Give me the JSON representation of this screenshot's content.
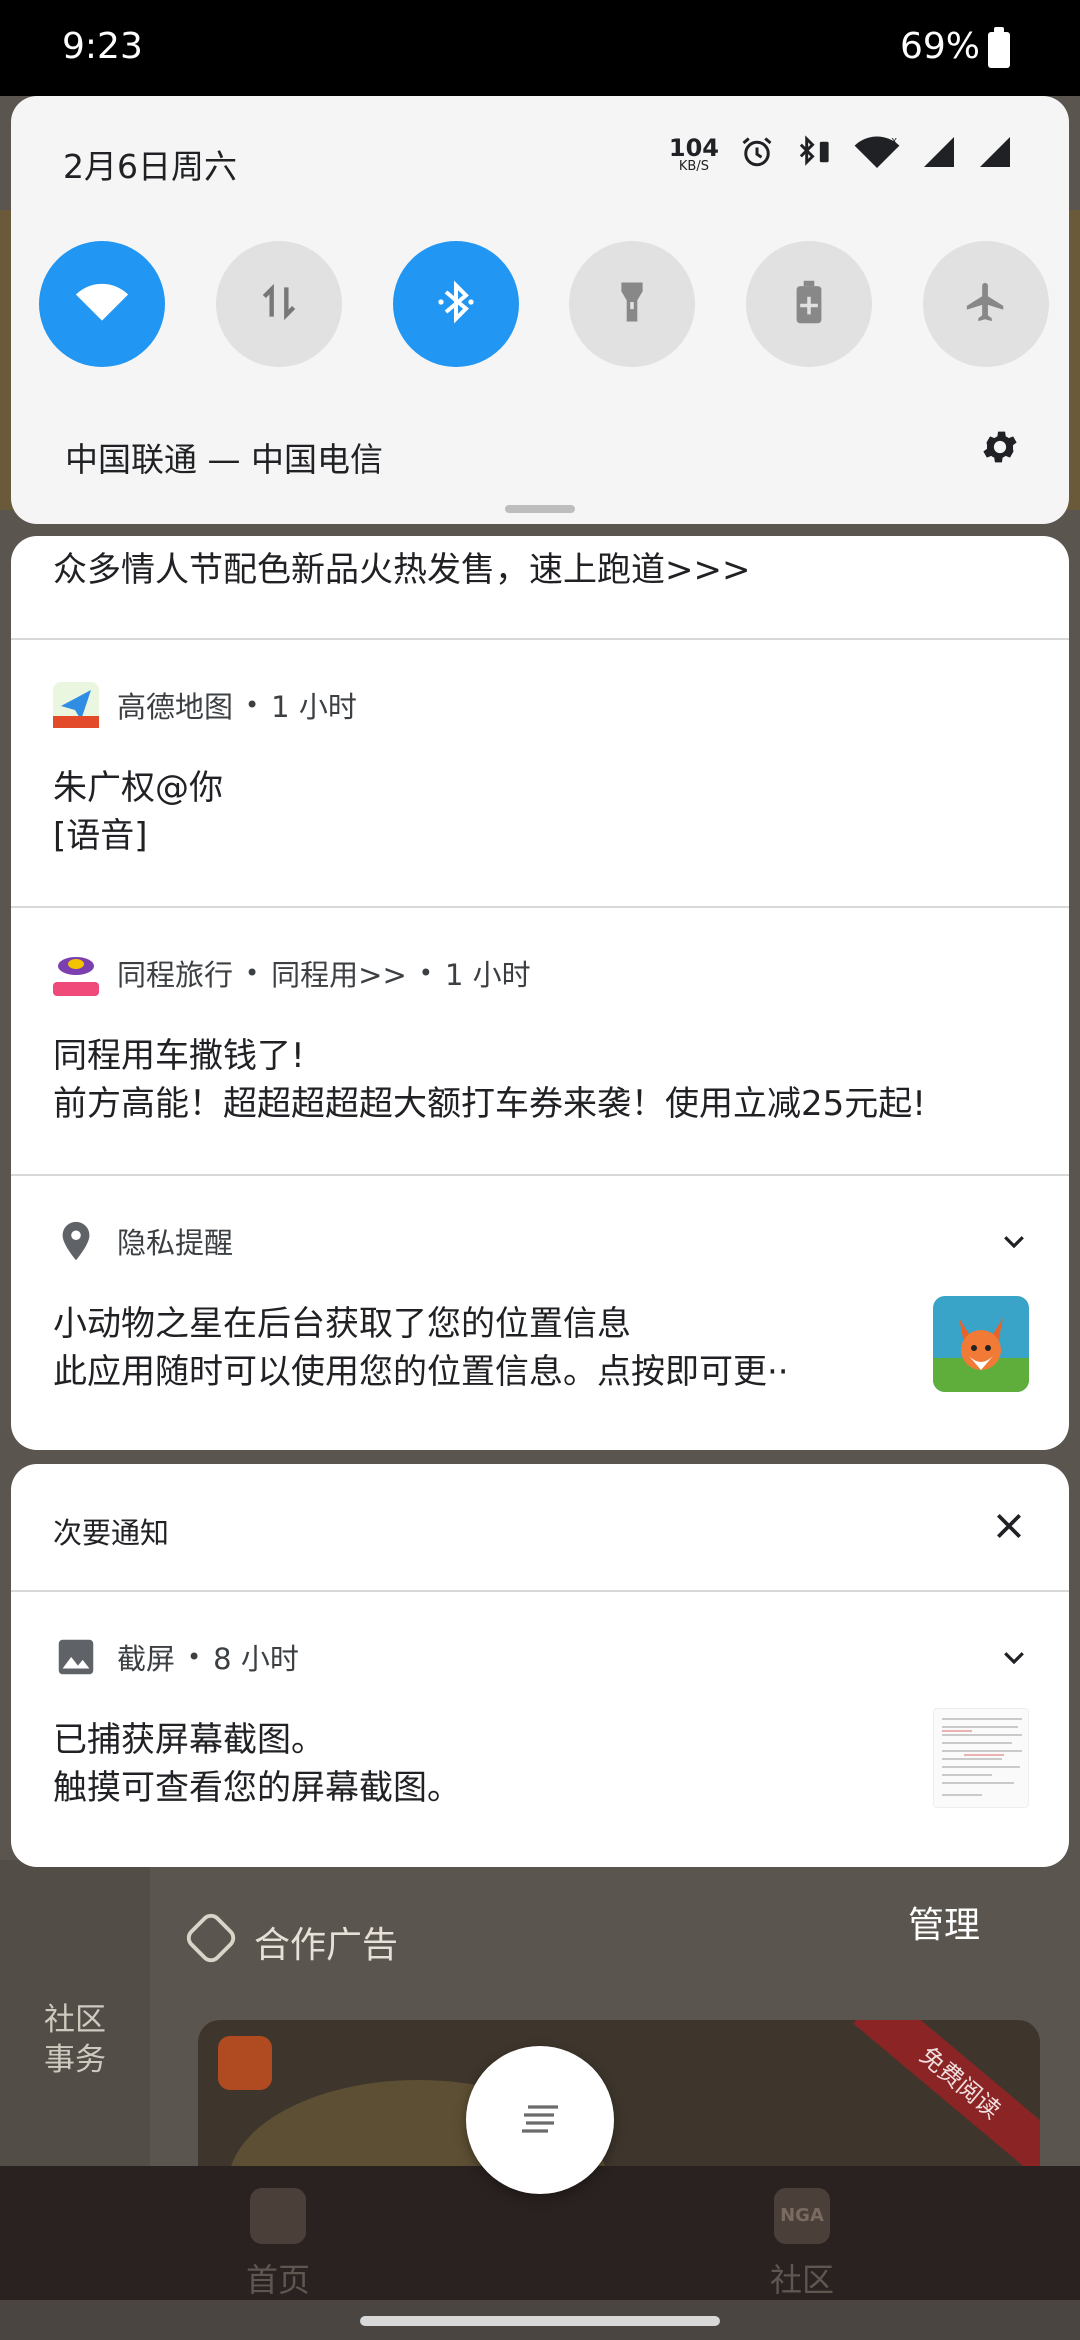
{
  "status_bar": {
    "time": "9:23",
    "battery": "69%"
  },
  "quick_settings": {
    "date": "2月6日周六",
    "speed_value": "104",
    "speed_unit": "KB/S",
    "carrier": "中国联通 — 中国电信",
    "tiles": [
      {
        "name": "wifi",
        "on": true
      },
      {
        "name": "mobile-data",
        "on": false
      },
      {
        "name": "bluetooth",
        "on": true
      },
      {
        "name": "flashlight",
        "on": false
      },
      {
        "name": "battery-saver",
        "on": false
      },
      {
        "name": "airplane-mode",
        "on": false
      }
    ],
    "accent_color": "#2196f3"
  },
  "notifications": {
    "partial_text": "众多情人节配色新品火热发售，速上跑道>>>",
    "amap": {
      "app_name": "高德地图",
      "time": "1 小时",
      "title": "朱广权@你",
      "body": "[语音]"
    },
    "tongcheng": {
      "app_name": "同程旅行",
      "channel": "同程用>>",
      "time": "1 小时",
      "title": "同程用车撒钱了!",
      "body": "前方高能！超超超超超大额打车券来袭！使用立减25元起!"
    },
    "privacy": {
      "app_name": "隐私提醒",
      "title": "小动物之星在后台获取了您的位置信息",
      "body": "此应用随时可以使用您的位置信息。点按即可更··"
    },
    "secondary": {
      "header": "次要通知",
      "screenshot": {
        "app_name": "截屏",
        "time": "8 小时",
        "title": "已捕获屏幕截图。",
        "body": "触摸可查看您的屏幕截图。"
      }
    }
  },
  "background_app": {
    "side_label": "社区事务",
    "ad_title": "合作广告",
    "manage": "管理",
    "ad_badge": "免费阅读",
    "nav_home": "首页",
    "nav_community": "社区",
    "nav_logo": "NGA"
  }
}
